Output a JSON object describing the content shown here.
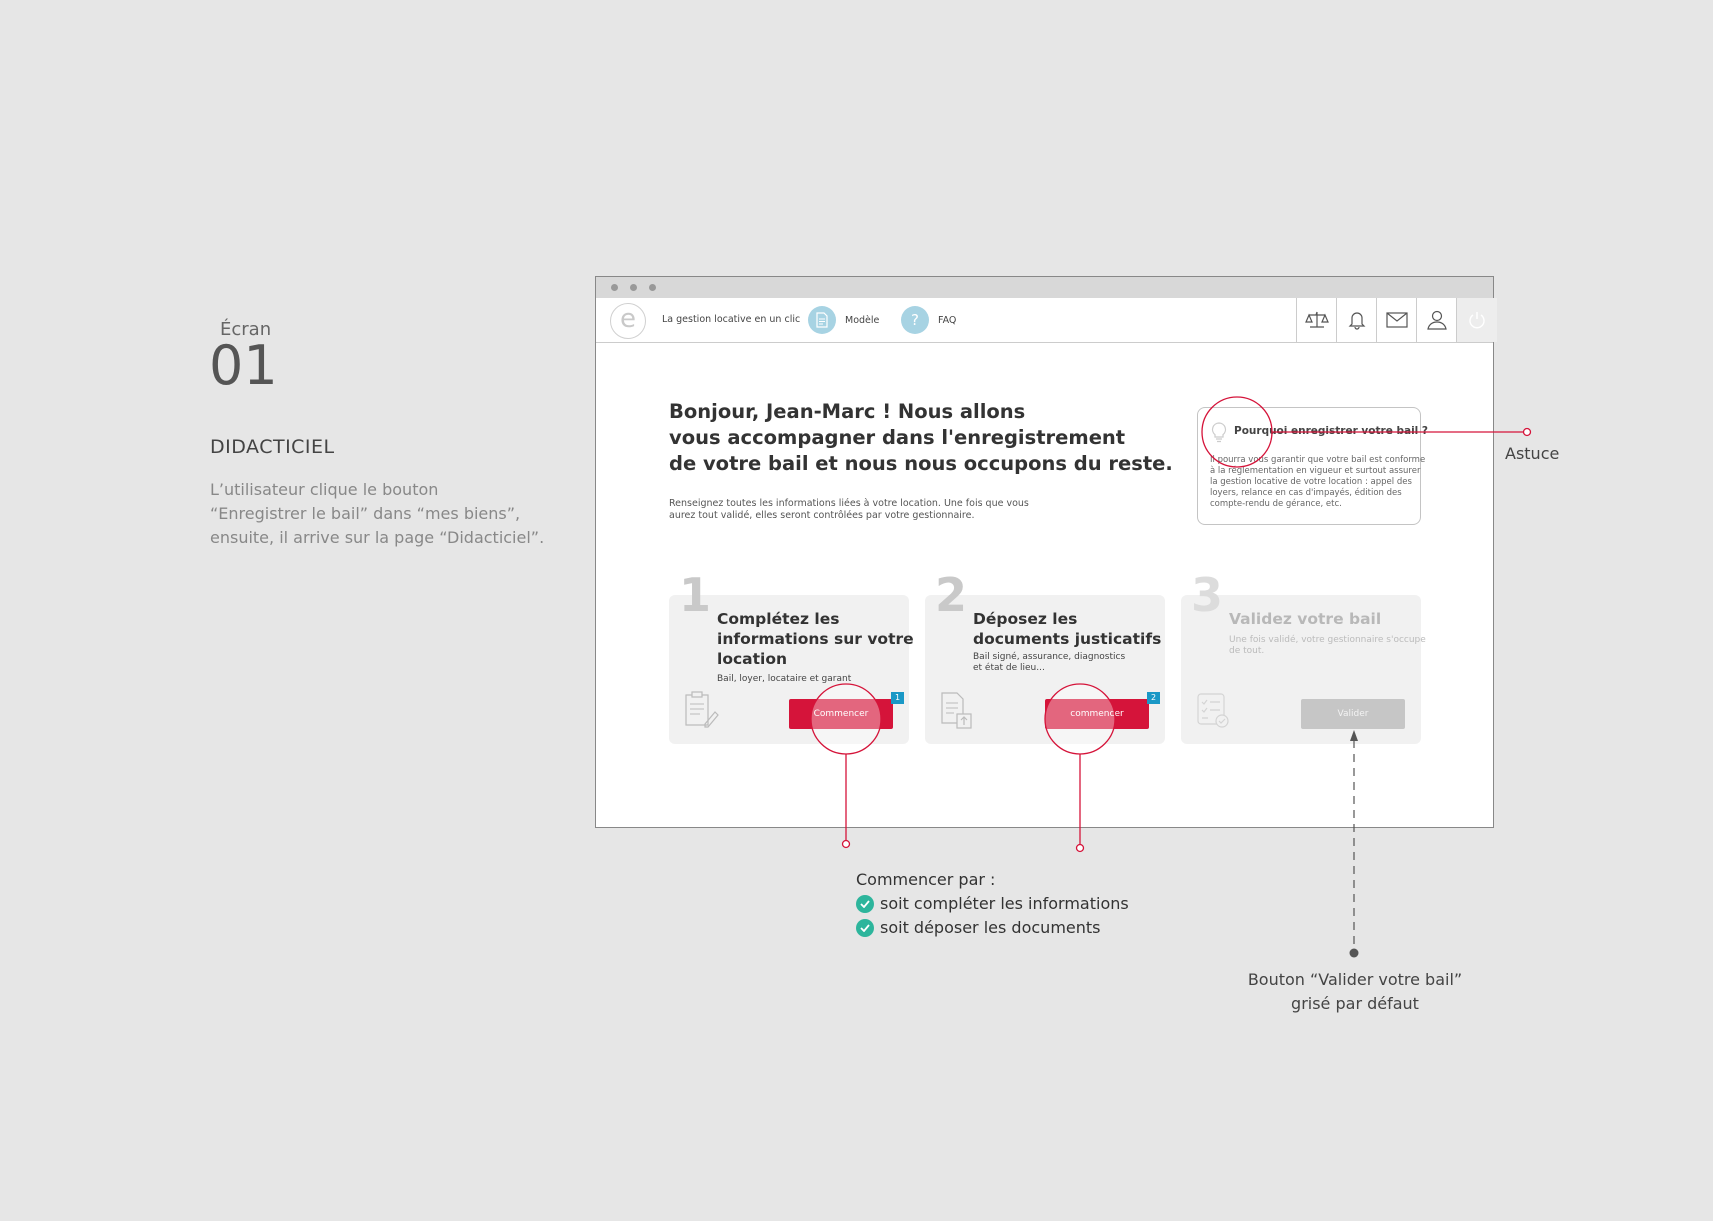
{
  "annotation": {
    "screen_label": "Écran",
    "screen_number": "01",
    "screen_title": "DIDACTICIEL",
    "description": [
      "L’utilisateur clique le bouton",
      "“Enregistrer le bail” dans “mes biens”,",
      "ensuite, il arrive sur la page “Didacticiel”."
    ],
    "astuce_label": "Astuce",
    "commencer_title": "Commencer par :",
    "commencer_items": [
      "soit compléter les informations",
      "soit déposer les documents"
    ],
    "valider_note": [
      "Bouton “Valider votre bail”",
      "grisé par défaut"
    ]
  },
  "app": {
    "logo_letter": "e",
    "tagline": "La gestion locative en un clic",
    "nav": [
      {
        "label": "Modèle",
        "icon": "document-icon"
      },
      {
        "label": "FAQ",
        "icon": "question-icon",
        "glyph": "?"
      }
    ],
    "toolbar_icons": [
      "scales-icon",
      "bell-icon",
      "mail-icon",
      "user-icon",
      "power-icon"
    ]
  },
  "main": {
    "greeting": [
      "Bonjour, Jean-Marc ! Nous allons",
      "vous accompagner dans l'enregistrement",
      "de votre bail et nous nous occupons du reste."
    ],
    "intro": [
      "Renseignez toutes les informations liées à votre location. Une fois que vous",
      "aurez tout validé, elles seront contrôlées par votre gestionnaire."
    ],
    "tip": {
      "title": "Pourquoi enregistrer votre bail ?",
      "text": [
        "Il pourra vous garantir que votre bail est conforme",
        "à la réglementation en vigueur et surtout assurer",
        "la gestion locative de votre location : appel des",
        "loyers, relance en cas d'impayés, édition des",
        "compte-rendu de gérance, etc."
      ]
    },
    "steps": [
      {
        "number": "1",
        "title": [
          "Complétez les",
          "informations sur votre",
          "location"
        ],
        "desc": [
          "Bail, loyer, locataire et garant"
        ],
        "button": "Commencer",
        "badge": "1"
      },
      {
        "number": "2",
        "title": [
          "Déposez les",
          "documents justicatifs"
        ],
        "desc": [
          "Bail signé, assurance, diagnostics",
          "et état de lieu..."
        ],
        "button": "commencer",
        "badge": "2"
      },
      {
        "number": "3",
        "title": [
          "Validez votre bail"
        ],
        "desc": [
          "Une fois validé, votre gestionnaire s'occupe",
          "de tout."
        ],
        "button": "Valider"
      }
    ]
  },
  "colors": {
    "accent": "#d5143a",
    "annotation_line": "#d5143a",
    "nav_icon_bg": "#a7d3e3",
    "badge": "#1a98c6",
    "check": "#2db59c",
    "disabled": "#c6c6c6"
  }
}
